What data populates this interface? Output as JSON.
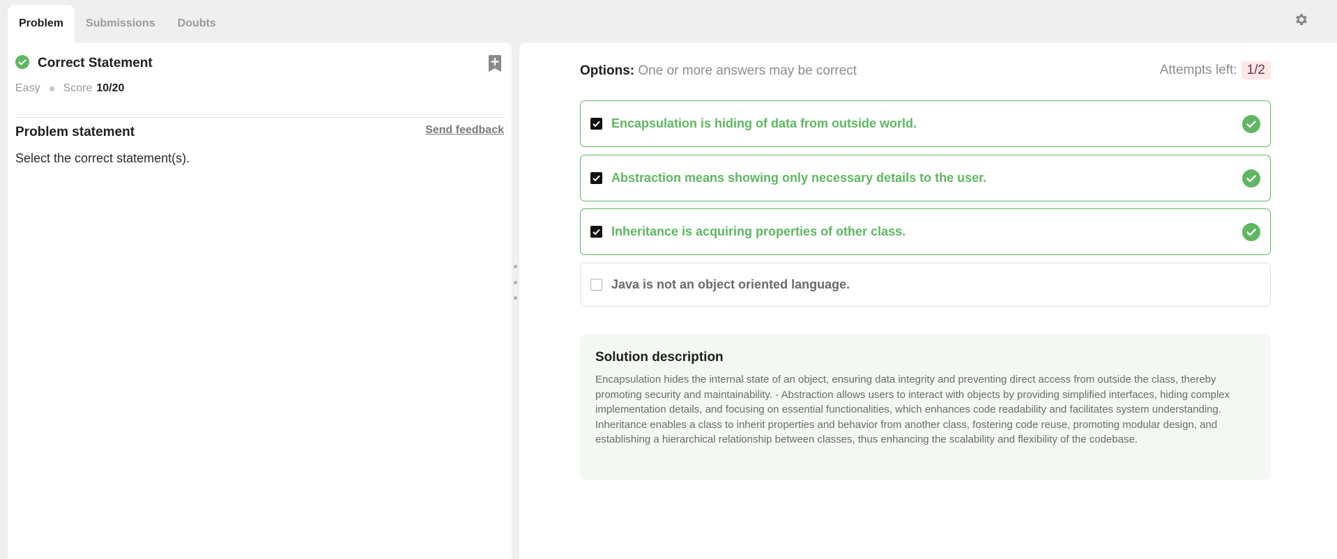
{
  "tabs": [
    {
      "label": "Problem",
      "active": true
    },
    {
      "label": "Submissions",
      "active": false
    },
    {
      "label": "Doubts",
      "active": false
    }
  ],
  "settings_icon": "gear-icon",
  "problem": {
    "title": "Correct Statement",
    "difficulty": "Easy",
    "score_label": "Score",
    "score_value": "10/20",
    "statement_heading": "Problem statement",
    "feedback_link": "Send feedback",
    "statement": "Select the correct statement(s)."
  },
  "options_panel": {
    "label": "Options:",
    "hint": "One or more answers may be correct",
    "attempts_label": "Attempts left:",
    "attempts_value": "1/2",
    "options": [
      {
        "text": "Encapsulation is hiding of data from outside world.",
        "checked": true,
        "correct": true
      },
      {
        "text": "Abstraction means showing only necessary details to the user.",
        "checked": true,
        "correct": true
      },
      {
        "text": "Inheritance is acquiring properties of other class.",
        "checked": true,
        "correct": true
      },
      {
        "text": "Java is not an object oriented language.",
        "checked": false,
        "correct": false
      }
    ]
  },
  "solution": {
    "heading": "Solution description",
    "text": "Encapsulation hides the internal state of an object, ensuring data integrity and preventing direct access from outside the class, thereby promoting security and maintainability. - Abstraction allows users to interact with objects by providing simplified interfaces, hiding complex implementation details, and focusing on essential functionalities, which enhances code readability and facilitates system understanding. Inheritance enables a class to inherit properties and behavior from another class, fostering code reuse, promoting modular design, and establishing a hierarchical relationship between classes, thus enhancing the scalability and flexibility of the codebase."
  },
  "colors": {
    "correct_green": "#5fb763",
    "attempt_badge_bg": "#fde8e8",
    "solution_bg": "#f3f8f3",
    "page_bg": "#efefef"
  }
}
